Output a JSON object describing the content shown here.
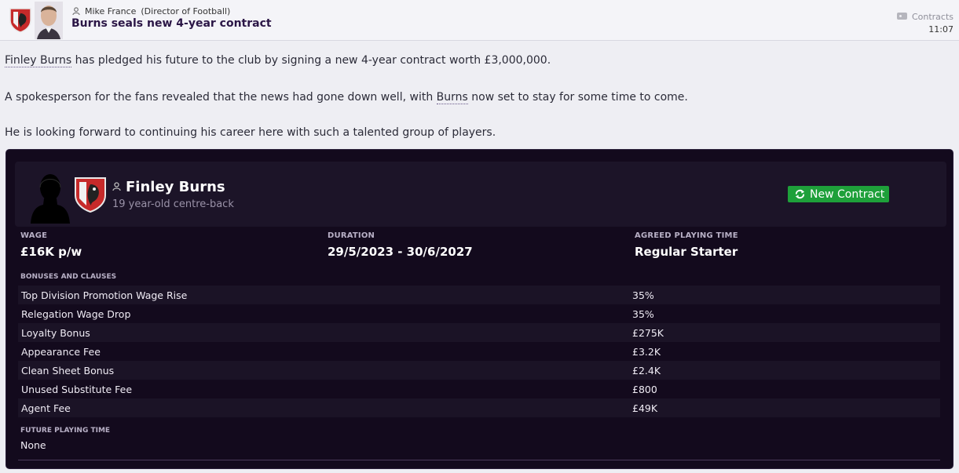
{
  "header": {
    "sender_name": "Mike France",
    "sender_role": "(Director of Football)",
    "subject": "Burns seals new 4-year contract",
    "category": "Contracts",
    "time": "11:07"
  },
  "message": {
    "p1_link": "Finley Burns",
    "p1_text": " has pledged his future to the club by signing a new 4-year contract worth £3,000,000.",
    "p2_before": "A spokesperson for the fans revealed that the news had gone down well, with ",
    "p2_link": "Burns",
    "p2_after": " now set to stay for some time to come.",
    "p3_text": "He is looking forward to continuing his career here with such a talented group of players."
  },
  "player": {
    "name": "Finley Burns",
    "description": "19 year-old centre-back",
    "badge": "New Contract"
  },
  "contract": {
    "wage_label": "WAGE",
    "wage_value": "£16K p/w",
    "duration_label": "DURATION",
    "duration_value": "29/5/2023 - 30/6/2027",
    "playing_time_label": "AGREED PLAYING TIME",
    "playing_time_value": "Regular Starter",
    "bonuses_label": "BONUSES AND CLAUSES",
    "bonuses": [
      {
        "name": "Top Division Promotion Wage Rise",
        "value": "35%"
      },
      {
        "name": "Relegation Wage Drop",
        "value": "35%"
      },
      {
        "name": "Loyalty Bonus",
        "value": "£275K"
      },
      {
        "name": "Appearance Fee",
        "value": "£3.2K"
      },
      {
        "name": "Clean Sheet Bonus",
        "value": "£2.4K"
      },
      {
        "name": "Unused Substitute Fee",
        "value": "£800"
      },
      {
        "name": "Agent Fee",
        "value": "£49K"
      }
    ],
    "future_label": "FUTURE PLAYING TIME",
    "future_value": "None"
  },
  "colors": {
    "card_background": "#130a1d",
    "accent_green": "#1ea03a",
    "club_red": "#c62a2a"
  },
  "icons": {
    "sender": "person-icon",
    "category": "tag-icon",
    "badge": "refresh-icon"
  }
}
